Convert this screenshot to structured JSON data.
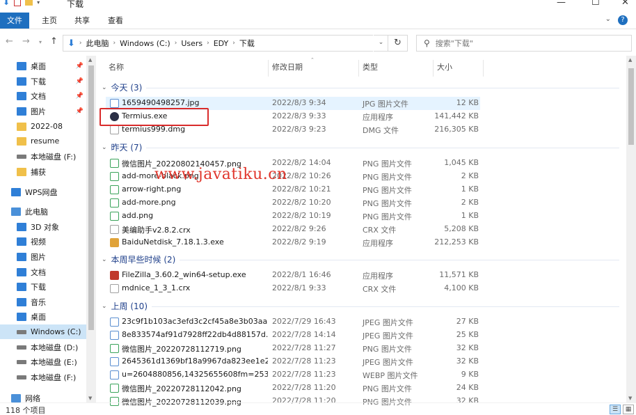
{
  "window": {
    "title": "下载",
    "controls": {
      "minimize": "—",
      "maximize": "☐",
      "close": "✕"
    }
  },
  "ribbon": {
    "tabs": [
      "文件",
      "主页",
      "共享",
      "查看"
    ],
    "help": "?",
    "toggle": "⌄"
  },
  "address": {
    "segments": [
      "此电脑",
      "Windows (C:)",
      "Users",
      "EDY",
      "下载"
    ],
    "search_placeholder": "搜索\"下载\""
  },
  "sidebar": {
    "items": [
      {
        "label": "桌面",
        "icon": "desktop-icon",
        "pinned": true
      },
      {
        "label": "下载",
        "icon": "download-icon",
        "pinned": true
      },
      {
        "label": "文档",
        "icon": "document-icon",
        "pinned": true
      },
      {
        "label": "图片",
        "icon": "picture-icon",
        "pinned": true
      },
      {
        "label": "2022-08",
        "icon": "folder-icon",
        "pinned": false
      },
      {
        "label": "resume",
        "icon": "folder-icon",
        "pinned": false
      },
      {
        "label": "本地磁盘 (F:)",
        "icon": "drive-icon",
        "pinned": false
      },
      {
        "label": "捕获",
        "icon": "folder-icon",
        "pinned": false
      },
      {
        "label": "WPS网盘",
        "icon": "cloud-icon",
        "pinned": false
      },
      {
        "label": "此电脑",
        "icon": "computer-icon",
        "pinned": false
      },
      {
        "label": "3D 对象",
        "icon": "3d-objects-icon",
        "pinned": false
      },
      {
        "label": "视频",
        "icon": "video-icon",
        "pinned": false
      },
      {
        "label": "图片",
        "icon": "picture-icon",
        "pinned": false
      },
      {
        "label": "文档",
        "icon": "document-icon",
        "pinned": false
      },
      {
        "label": "下载",
        "icon": "download-icon",
        "pinned": false
      },
      {
        "label": "音乐",
        "icon": "music-icon",
        "pinned": false
      },
      {
        "label": "桌面",
        "icon": "desktop-icon",
        "pinned": false
      },
      {
        "label": "Windows (C:)",
        "icon": "drive-icon",
        "pinned": false,
        "selected": true
      },
      {
        "label": "本地磁盘 (D:)",
        "icon": "drive-icon",
        "pinned": false
      },
      {
        "label": "本地磁盘 (E:)",
        "icon": "drive-icon",
        "pinned": false
      },
      {
        "label": "本地磁盘 (F:)",
        "icon": "drive-icon",
        "pinned": false
      },
      {
        "label": "网络",
        "icon": "network-icon",
        "pinned": false
      }
    ]
  },
  "columns": {
    "name": "名称",
    "date": "修改日期",
    "type": "类型",
    "size": "大小"
  },
  "groups": [
    {
      "label": "今天 (3)",
      "files": [
        {
          "name": "1659490498257.jpg",
          "date": "2022/8/3 9:34",
          "type": "JPG 图片文件",
          "size": "12 KB",
          "icon": "image-file-icon"
        },
        {
          "name": "Termius.exe",
          "date": "2022/8/3 9:33",
          "type": "应用程序",
          "size": "141,442 KB",
          "icon": "termius-icon"
        },
        {
          "name": "termius999.dmg",
          "date": "2022/8/3 9:23",
          "type": "DMG 文件",
          "size": "216,305 KB",
          "icon": "file-icon"
        }
      ]
    },
    {
      "label": "昨天 (7)",
      "files": [
        {
          "name": "微信图片_20220802140457.png",
          "date": "2022/8/2 14:04",
          "type": "PNG 图片文件",
          "size": "1,045 KB",
          "icon": "png-file-icon"
        },
        {
          "name": "add-more-black.png",
          "date": "2022/8/2 10:26",
          "type": "PNG 图片文件",
          "size": "2 KB",
          "icon": "png-file-icon"
        },
        {
          "name": "arrow-right.png",
          "date": "2022/8/2 10:21",
          "type": "PNG 图片文件",
          "size": "1 KB",
          "icon": "png-file-icon"
        },
        {
          "name": "add-more.png",
          "date": "2022/8/2 10:20",
          "type": "PNG 图片文件",
          "size": "2 KB",
          "icon": "png-file-icon"
        },
        {
          "name": "add.png",
          "date": "2022/8/2 10:19",
          "type": "PNG 图片文件",
          "size": "1 KB",
          "icon": "png-file-icon"
        },
        {
          "name": "美编助手v2.8.2.crx",
          "date": "2022/8/2 9:26",
          "type": "CRX 文件",
          "size": "5,208 KB",
          "icon": "file-icon"
        },
        {
          "name": "BaiduNetdisk_7.18.1.3.exe",
          "date": "2022/8/2 9:19",
          "type": "应用程序",
          "size": "212,253 KB",
          "icon": "baidu-netdisk-icon"
        }
      ]
    },
    {
      "label": "本周早些时候 (2)",
      "files": [
        {
          "name": "FileZilla_3.60.2_win64-setup.exe",
          "date": "2022/8/1 16:46",
          "type": "应用程序",
          "size": "11,571 KB",
          "icon": "filezilla-icon"
        },
        {
          "name": "mdnice_1_3_1.crx",
          "date": "2022/8/1 9:33",
          "type": "CRX 文件",
          "size": "4,100 KB",
          "icon": "file-icon"
        }
      ]
    },
    {
      "label": "上周 (10)",
      "files": [
        {
          "name": "23c9f1b103ac3efd3c2cf45a8e3b03aa...",
          "date": "2022/7/29 16:43",
          "type": "JPEG 图片文件",
          "size": "27 KB",
          "icon": "image-file-icon"
        },
        {
          "name": "8e833574af91d7928ff22db4d88157d...",
          "date": "2022/7/28 14:14",
          "type": "JPEG 图片文件",
          "size": "25 KB",
          "icon": "image-file-icon"
        },
        {
          "name": "微信图片_20220728112719.png",
          "date": "2022/7/28 11:27",
          "type": "PNG 图片文件",
          "size": "32 KB",
          "icon": "png-file-icon"
        },
        {
          "name": "2645361d1369bf18a9967da823ee1e2...",
          "date": "2022/7/28 11:23",
          "type": "JPEG 图片文件",
          "size": "32 KB",
          "icon": "image-file-icon"
        },
        {
          "name": "u=2604880856,14325655608fm=253...",
          "date": "2022/7/28 11:23",
          "type": "WEBP 图片文件",
          "size": "9 KB",
          "icon": "webp-file-icon"
        },
        {
          "name": "微信图片_20220728112042.png",
          "date": "2022/7/28 11:20",
          "type": "PNG 图片文件",
          "size": "24 KB",
          "icon": "png-file-icon"
        },
        {
          "name": "微信图片_20220728112039.png",
          "date": "2022/7/28 11:20",
          "type": "PNG 图片文件",
          "size": "32 KB",
          "icon": "png-file-icon"
        }
      ]
    }
  ],
  "watermark": "www.javatiku.cn",
  "status": {
    "item_count": "118 个项目"
  }
}
